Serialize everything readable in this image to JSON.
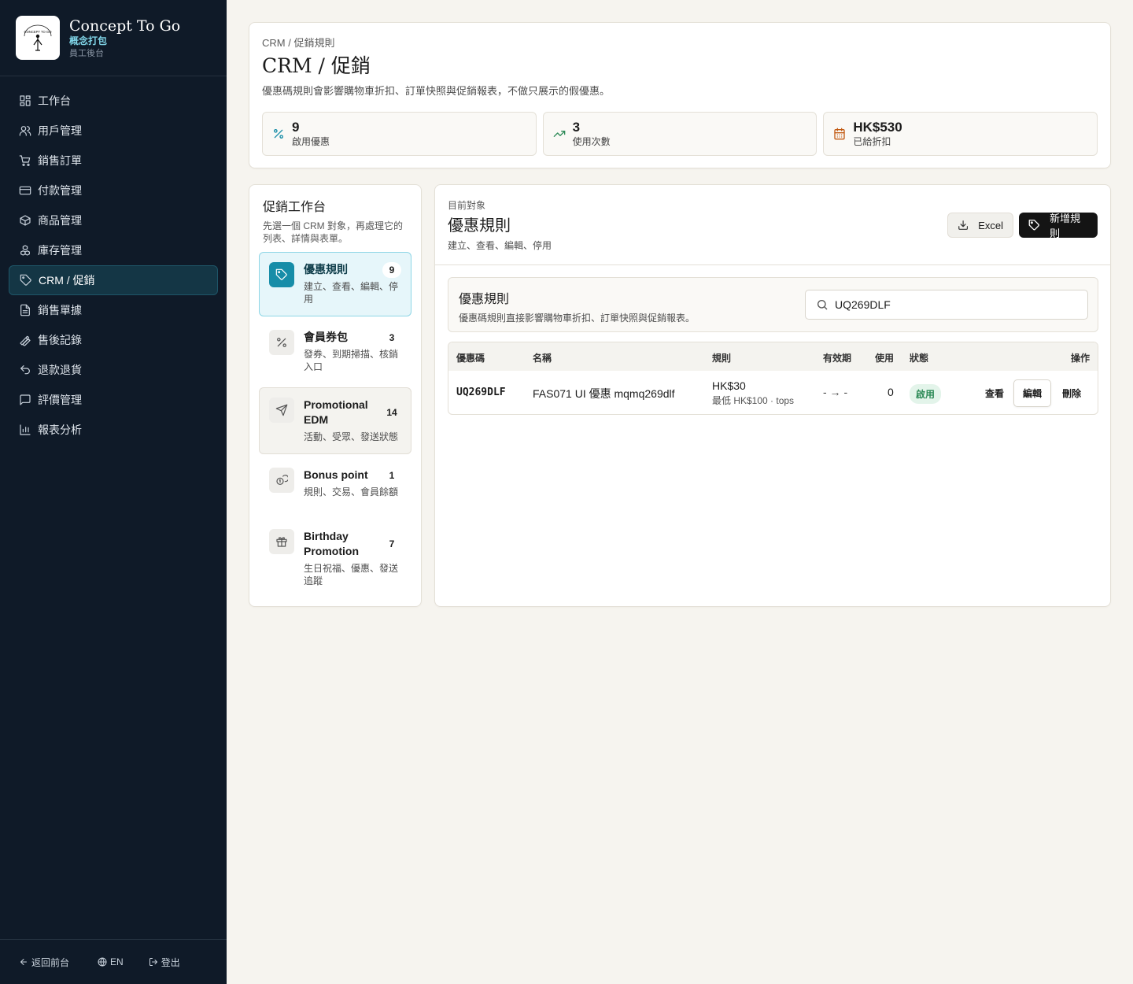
{
  "brand": {
    "name": "Concept To Go",
    "subtitle": "概念打包",
    "caption": "員工後台"
  },
  "nav": [
    {
      "label": "工作台",
      "icon": "dashboard-icon"
    },
    {
      "label": "用戶管理",
      "icon": "users-icon"
    },
    {
      "label": "銷售訂單",
      "icon": "cart-icon"
    },
    {
      "label": "付款管理",
      "icon": "credit-card-icon"
    },
    {
      "label": "商品管理",
      "icon": "box-icon"
    },
    {
      "label": "庫存管理",
      "icon": "boxes-icon"
    },
    {
      "label": "CRM / 促銷",
      "icon": "tag-icon",
      "active": true
    },
    {
      "label": "銷售單據",
      "icon": "file-icon"
    },
    {
      "label": "售後記錄",
      "icon": "wrench-icon"
    },
    {
      "label": "退款退貨",
      "icon": "undo-icon"
    },
    {
      "label": "評價管理",
      "icon": "message-icon"
    },
    {
      "label": "報表分析",
      "icon": "bar-chart-icon"
    }
  ],
  "footer": {
    "back": "返回前台",
    "lang": "EN",
    "logout": "登出"
  },
  "header": {
    "breadcrumb": "CRM / 促銷規則",
    "title": "CRM / 促銷",
    "description": "優惠碼規則會影響購物車折扣、訂單快照與促銷報表，不做只展示的假優惠。",
    "stats": [
      {
        "value": "9",
        "label": "啟用優惠",
        "icon": "percent-icon",
        "color": "#178da8"
      },
      {
        "value": "3",
        "label": "使用次數",
        "icon": "trending-up-icon",
        "color": "#2d8a57"
      },
      {
        "value": "HK$530",
        "label": "已給折扣",
        "icon": "calendar-icon",
        "color": "#c25a12"
      }
    ]
  },
  "workbench": {
    "title": "促銷工作台",
    "description": "先選一個 CRM 對象，再處理它的列表、詳情與表單。",
    "items": [
      {
        "title": "優惠規則",
        "count": "9",
        "desc": "建立、查看、編輯、停用",
        "icon": "tag-icon"
      },
      {
        "title": "會員券包",
        "count": "3",
        "desc": "發券、到期掃描、核銷入口",
        "icon": "percent-icon"
      },
      {
        "title": "Promotional EDM",
        "count": "14",
        "desc": "活動、受眾、發送狀態",
        "icon": "send-icon"
      },
      {
        "title": "Bonus point",
        "count": "1",
        "desc": "規則、交易、會員餘額",
        "icon": "coins-icon"
      },
      {
        "title": "Birthday Promotion",
        "count": "7",
        "desc": "生日祝福、優惠、發送追蹤",
        "icon": "gift-icon"
      }
    ]
  },
  "main": {
    "current_label": "目前對象",
    "title": "優惠規則",
    "description": "建立、查看、編輯、停用",
    "excel_label": "Excel",
    "new_label": "新增規則",
    "section_title": "優惠規則",
    "section_desc": "優惠碼規則直接影響購物車折扣、訂單快照與促銷報表。",
    "search_value": "UQ269DLF",
    "columns": [
      "優惠碼",
      "名稱",
      "規則",
      "有效期",
      "使用",
      "狀態",
      "操作"
    ],
    "rows": [
      {
        "code": "UQ269DLF",
        "name": "FAS071 UI 優惠 mqmq269dlf",
        "rule": "HK$30",
        "rule_sub": "最低 HK$100 · tops",
        "period": "- → -",
        "usage": "0",
        "status": "啟用",
        "actions": [
          "查看",
          "編輯",
          "刪除"
        ]
      }
    ]
  }
}
